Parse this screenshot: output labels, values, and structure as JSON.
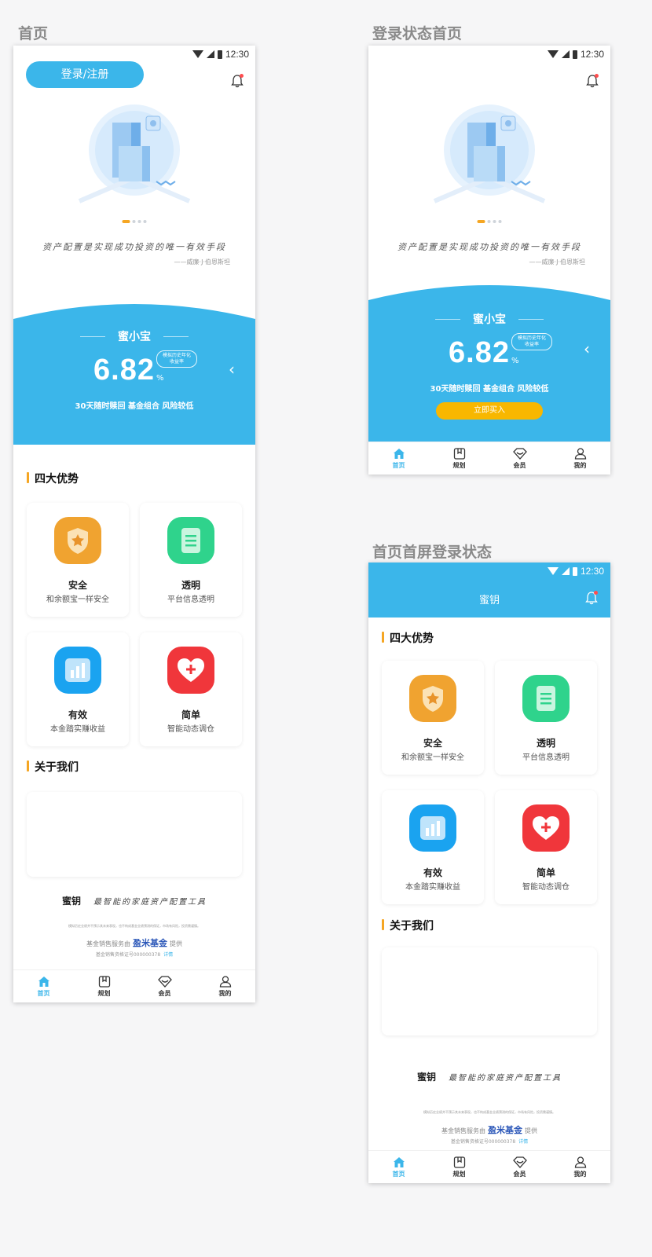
{
  "screens": {
    "home": {
      "label": "首页",
      "status_time": "12:30",
      "login_button": "登录/注册",
      "quote": "资产配置是实现成功投资的唯一有效手段",
      "quote_author": "——威廉·J·伯恩斯坦",
      "product": {
        "name": "蜜小宝",
        "rate": "6.82",
        "unit": "%",
        "bubble": "模拟历史年化收益率",
        "desc": "30天随时赎回 基金组合 风险较低"
      },
      "advantages_title": "四大优势",
      "advantages": [
        {
          "title": "安全",
          "sub": "和余额宝一样安全"
        },
        {
          "title": "透明",
          "sub": "平台信息透明"
        },
        {
          "title": "有效",
          "sub": "本金踏实赚收益"
        },
        {
          "title": "简单",
          "sub": "智能动态调仓"
        }
      ],
      "about_title": "关于我们",
      "brand": "蜜钥",
      "slogan": "最智能的家庭资产配置工具",
      "disclaimer": "模拟历史业绩并不预示其未来表现，也不构成基金业绩预测的保证，市场有风险，投资需谨慎。",
      "sales_prefix": "基金销售服务由",
      "sales_logo": "盈米基金",
      "sales_suffix": "提供",
      "license": "基金销售资格证号000000378",
      "license_link": "详情"
    },
    "logged_in": {
      "label": "登录状态首页",
      "status_time": "12:30",
      "quote": "资产配置是实现成功投资的唯一有效手段",
      "quote_author": "——威廉·J·伯恩斯坦",
      "product": {
        "name": "蜜小宝",
        "rate": "6.82",
        "unit": "%",
        "bubble": "模拟历史年化收益率",
        "desc": "30天随时赎回 基金组合 风险较低",
        "buy": "立即买入"
      }
    },
    "scrolled": {
      "label": "首页首屏登录状态",
      "status_time": "12:30",
      "title": "蜜钥",
      "advantages_title": "四大优势",
      "advantages": [
        {
          "title": "安全",
          "sub": "和余额宝一样安全"
        },
        {
          "title": "透明",
          "sub": "平台信息透明"
        },
        {
          "title": "有效",
          "sub": "本金踏实赚收益"
        },
        {
          "title": "简单",
          "sub": "智能动态调仓"
        }
      ],
      "about_title": "关于我们",
      "brand": "蜜钥",
      "slogan": "最智能的家庭资产配置工具",
      "disclaimer": "模拟历史业绩并不预示其未来表现，也不构成基金业绩预测的保证，市场有风险，投资需谨慎。",
      "sales_prefix": "基金销售服务由",
      "sales_logo": "盈米基金",
      "sales_suffix": "提供",
      "license": "基金销售资格证号000000378",
      "license_link": "详情"
    }
  },
  "tabs": [
    {
      "label": "首页",
      "icon": "home-icon"
    },
    {
      "label": "规划",
      "icon": "plan-icon"
    },
    {
      "label": "会员",
      "icon": "member-icon"
    },
    {
      "label": "我的",
      "icon": "profile-icon"
    }
  ],
  "colors": {
    "primary": "#3bb6ea",
    "accent": "#f5a623",
    "buy": "#f8b700",
    "safe": "#f0a330",
    "transparent": "#2fd38c",
    "effective": "#1aa3f0",
    "simple": "#f0363b"
  }
}
